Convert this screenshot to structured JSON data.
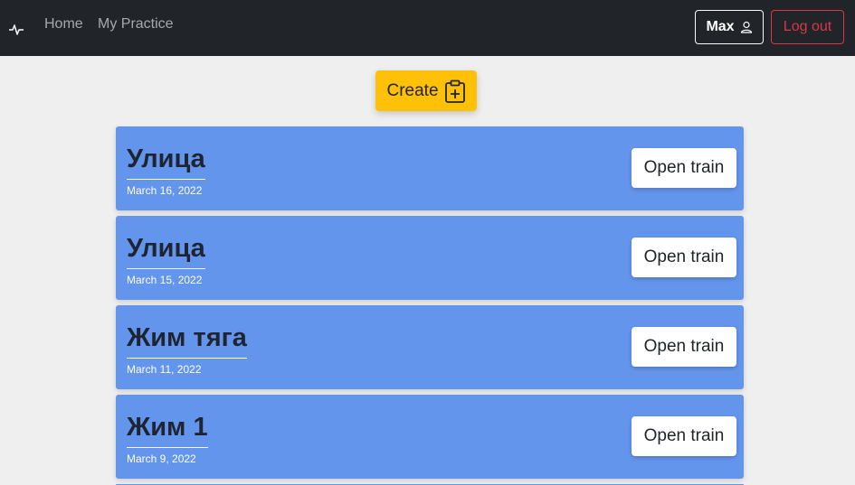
{
  "nav": {
    "home_label": "Home",
    "practice_label": "My Practice",
    "user_label": "Max",
    "logout_label": "Log out"
  },
  "create": {
    "label": "Create"
  },
  "colors": {
    "navbar": "#212529",
    "card": "#6495ed",
    "create": "#ffc107",
    "logout": "#dc3545"
  },
  "trainings": [
    {
      "title": "Улица",
      "date": "March 16, 2022",
      "button": "Open train"
    },
    {
      "title": "Улица",
      "date": "March 15, 2022",
      "button": "Open train"
    },
    {
      "title": "Жим тяга",
      "date": "March 11, 2022",
      "button": "Open train"
    },
    {
      "title": "Жим 1",
      "date": "March 9, 2022",
      "button": "Open train"
    }
  ]
}
